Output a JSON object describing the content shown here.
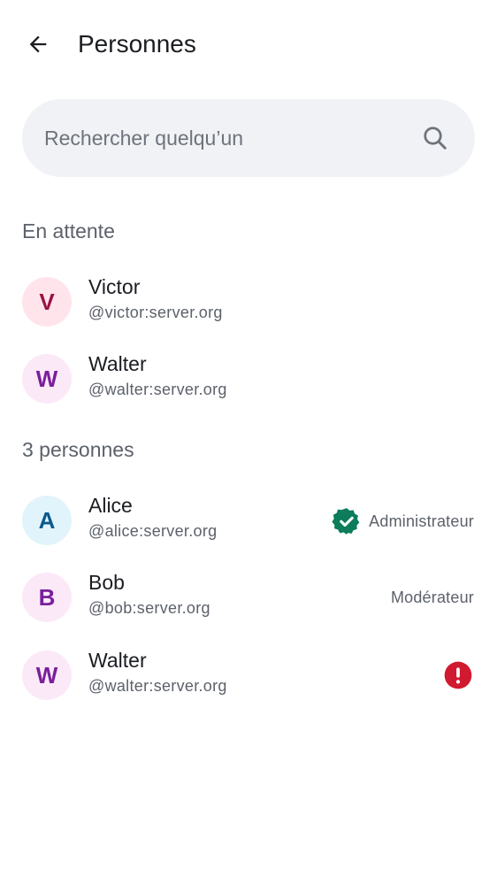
{
  "header": {
    "title": "Personnes",
    "back_icon": "arrow-left-icon"
  },
  "search": {
    "placeholder": "Rechercher quelqu’un",
    "value": "",
    "icon": "search-icon"
  },
  "sections": {
    "pending": {
      "title": "En attente",
      "members": [
        {
          "initial": "V",
          "name": "Victor",
          "handle": "@victor:server.org",
          "avatar_bg": "#ffe5eb",
          "avatar_fg": "#9a1245"
        },
        {
          "initial": "W",
          "name": "Walter",
          "handle": "@walter:server.org",
          "avatar_bg": "#fbe9f8",
          "avatar_fg": "#7a1f9b"
        }
      ]
    },
    "joined": {
      "title": "3 personnes",
      "members": [
        {
          "initial": "A",
          "name": "Alice",
          "handle": "@alice:server.org",
          "avatar_bg": "#e1f4fb",
          "avatar_fg": "#0a5a8c",
          "role": "Administrateur",
          "role_icon": "verified-check-icon"
        },
        {
          "initial": "B",
          "name": "Bob",
          "handle": "@bob:server.org",
          "avatar_bg": "#fbe9f8",
          "avatar_fg": "#7a1f9b",
          "role": "Modérateur"
        },
        {
          "initial": "W",
          "name": "Walter",
          "handle": "@walter:server.org",
          "avatar_bg": "#fbe9f8",
          "avatar_fg": "#7a1f9b",
          "status_icon": "error-icon"
        }
      ]
    }
  },
  "colors": {
    "verified": "#0c7c5a",
    "error": "#d1192f"
  }
}
